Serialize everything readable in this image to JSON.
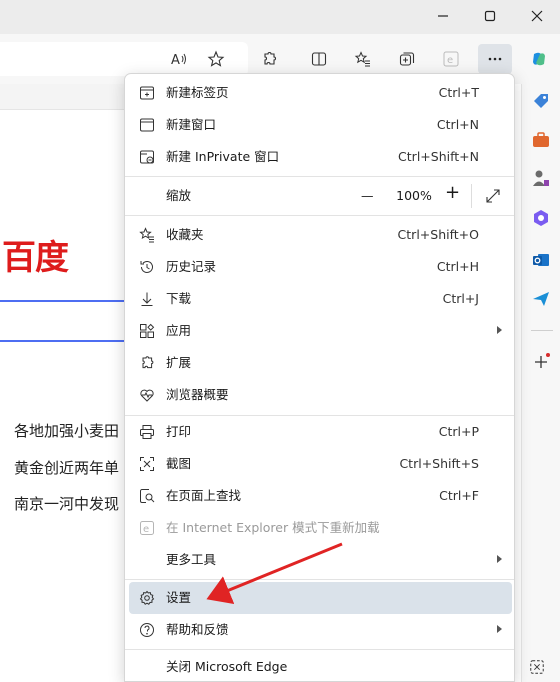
{
  "window": {
    "controls": [
      "minimize-icon",
      "maximize-icon",
      "close-icon"
    ]
  },
  "toolbar": {
    "icons": [
      "read-aloud-icon",
      "favorite-star-icon",
      "extensions-icon",
      "split-screen-icon",
      "favorites-icon",
      "collections-icon",
      "ie-mode-icon",
      "more-icon",
      "copilot-icon"
    ]
  },
  "page": {
    "logo_text": "百度",
    "news": [
      "各地加强小麦田",
      "黄金创近两年单",
      "南京一河中发现"
    ]
  },
  "menu": {
    "items": [
      {
        "label": "新建标签页",
        "shortcut": "Ctrl+T",
        "icon": "new-tab-icon"
      },
      {
        "label": "新建窗口",
        "shortcut": "Ctrl+N",
        "icon": "new-window-icon"
      },
      {
        "label": "新建 InPrivate 窗口",
        "shortcut": "Ctrl+Shift+N",
        "icon": "inprivate-icon"
      },
      {
        "label": "缩放",
        "zoom_value": "100%",
        "zoom_minus": "—",
        "zoom_plus": "+"
      },
      {
        "label": "收藏夹",
        "shortcut": "Ctrl+Shift+O",
        "icon": "favorites-icon"
      },
      {
        "label": "历史记录",
        "shortcut": "Ctrl+H",
        "icon": "history-icon"
      },
      {
        "label": "下载",
        "shortcut": "Ctrl+J",
        "icon": "download-icon"
      },
      {
        "label": "应用",
        "shortcut": "",
        "icon": "apps-icon",
        "submenu": true
      },
      {
        "label": "扩展",
        "shortcut": "",
        "icon": "extensions-icon"
      },
      {
        "label": "浏览器概要",
        "shortcut": "",
        "icon": "browser-essentials-icon"
      },
      {
        "label": "打印",
        "shortcut": "Ctrl+P",
        "icon": "print-icon"
      },
      {
        "label": "截图",
        "shortcut": "Ctrl+Shift+S",
        "icon": "screenshot-icon"
      },
      {
        "label": "在页面上查找",
        "shortcut": "Ctrl+F",
        "icon": "find-icon"
      },
      {
        "label": "在 Internet Explorer 模式下重新加载",
        "shortcut": "",
        "icon": "ie-reload-icon",
        "disabled": true
      },
      {
        "label": "更多工具",
        "shortcut": "",
        "submenu": true
      },
      {
        "label": "设置",
        "shortcut": "",
        "icon": "settings-icon",
        "highlighted": true
      },
      {
        "label": "帮助和反馈",
        "shortcut": "",
        "icon": "help-icon",
        "submenu": true
      },
      {
        "label": "关闭 Microsoft Edge",
        "shortcut": ""
      }
    ]
  },
  "colors": {
    "accent_arrow": "#e02424",
    "highlight": "#dae2ea",
    "baidu_red": "#de1c1c",
    "baidu_blue": "#4e6ef2"
  }
}
